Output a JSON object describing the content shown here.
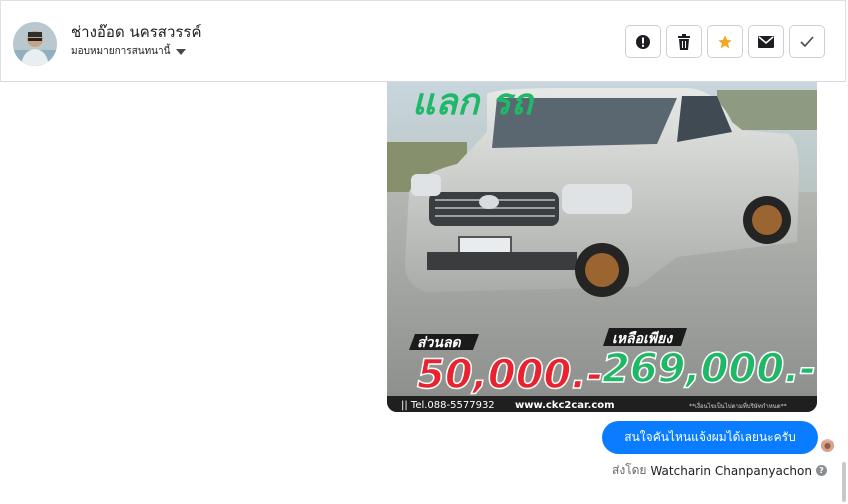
{
  "header": {
    "contact_name": "ช่างอ๊อด นครสวรรค์",
    "assign_label": "มอบหมายการสนทนานี้",
    "actions": [
      {
        "name": "report-icon"
      },
      {
        "name": "trash-icon"
      },
      {
        "name": "star-icon",
        "color": "#f5a623"
      },
      {
        "name": "mail-icon"
      },
      {
        "name": "check-icon"
      }
    ]
  },
  "ad": {
    "headline": "แลก รถ",
    "discount_label": "ส่วนลด",
    "discount_value": "50,000.-",
    "remaining_label": "เหลือเพียง",
    "price_value": "269,000.-",
    "phone": "|| Tel.088-5577932",
    "website": "www.ckc2car.com",
    "footnote": "**เงื่อนไขเป็นไปตามที่บริษัทกำหนด**"
  },
  "message": {
    "text": "สนใจคันไหนแจ้งผมได้เลยนะครับ",
    "sent_by_label": "ส่งโดย",
    "sender_name": "Watcharin Chanpanyachon"
  },
  "colors": {
    "bubble": "#0a7cff",
    "discount": "#e8232f",
    "price": "#1fb866"
  }
}
